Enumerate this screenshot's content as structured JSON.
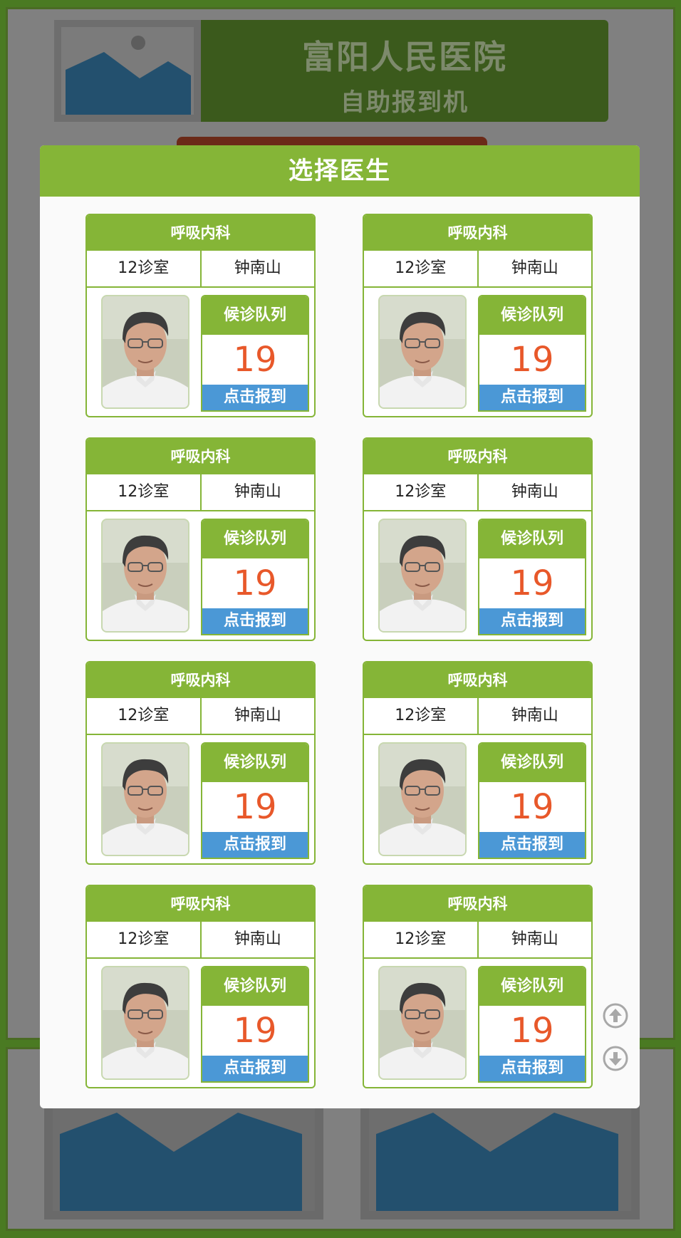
{
  "header": {
    "title": "富阳人民医院",
    "subtitle": "自助报到机"
  },
  "modal": {
    "title": "选择医生"
  },
  "doctors": [
    {
      "dept": "呼吸内科",
      "room": "12诊室",
      "name": "钟南山",
      "queue_label": "候诊队列",
      "queue_count": "19",
      "checkin_label": "点击报到"
    },
    {
      "dept": "呼吸内科",
      "room": "12诊室",
      "name": "钟南山",
      "queue_label": "候诊队列",
      "queue_count": "19",
      "checkin_label": "点击报到"
    },
    {
      "dept": "呼吸内科",
      "room": "12诊室",
      "name": "钟南山",
      "queue_label": "候诊队列",
      "queue_count": "19",
      "checkin_label": "点击报到"
    },
    {
      "dept": "呼吸内科",
      "room": "12诊室",
      "name": "钟南山",
      "queue_label": "候诊队列",
      "queue_count": "19",
      "checkin_label": "点击报到"
    },
    {
      "dept": "呼吸内科",
      "room": "12诊室",
      "name": "钟南山",
      "queue_label": "候诊队列",
      "queue_count": "19",
      "checkin_label": "点击报到"
    },
    {
      "dept": "呼吸内科",
      "room": "12诊室",
      "name": "钟南山",
      "queue_label": "候诊队列",
      "queue_count": "19",
      "checkin_label": "点击报到"
    },
    {
      "dept": "呼吸内科",
      "room": "12诊室",
      "name": "钟南山",
      "queue_label": "候诊队列",
      "queue_count": "19",
      "checkin_label": "点击报到"
    },
    {
      "dept": "呼吸内科",
      "room": "12诊室",
      "name": "钟南山",
      "queue_label": "候诊队列",
      "queue_count": "19",
      "checkin_label": "点击报到"
    }
  ],
  "icons": {
    "scroll_up": "arrow-up-circle-icon",
    "scroll_down": "arrow-down-circle-icon",
    "placeholder": "image-placeholder-icon",
    "avatar": "doctor-photo"
  },
  "colors": {
    "primary_green": "#85b537",
    "header_dark_green": "#3b5a1c",
    "checkin_blue": "#4b98d6",
    "queue_number": "#e8582a",
    "placeholder_blue": "#23506e"
  }
}
